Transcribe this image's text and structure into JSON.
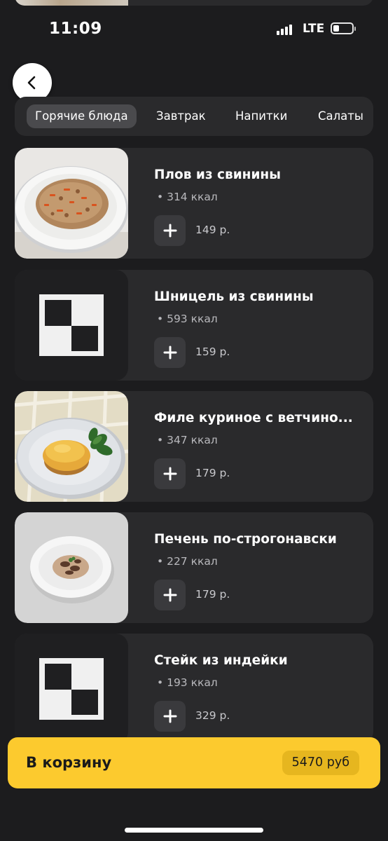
{
  "status_bar": {
    "time": "11:09",
    "network": "LTE",
    "signal_icon": "cellular-signal-icon",
    "battery_icon": "battery-low-icon"
  },
  "nav": {
    "back_icon": "chevron-left-icon"
  },
  "tabs": [
    {
      "label": "Горячие блюда",
      "active": true
    },
    {
      "label": "Завтрак",
      "active": false
    },
    {
      "label": "Напитки",
      "active": false
    },
    {
      "label": "Салаты",
      "active": false
    }
  ],
  "items": [
    {
      "name": "Плов из свинины",
      "kcal": "314 ккал",
      "price": "149 р.",
      "image": "photo-pilaf"
    },
    {
      "name": "Шницель из свинины",
      "kcal": "593 ккал",
      "price": "159 р.",
      "image": "placeholder-image-icon"
    },
    {
      "name": "Филе куриное с ветчино...",
      "kcal": "347 ккал",
      "price": "179 р.",
      "image": "photo-chicken"
    },
    {
      "name": "Печень по-строгонавски",
      "kcal": "227 ккал",
      "price": "179 р.",
      "image": "photo-liver"
    },
    {
      "name": "Стейк из индейки",
      "kcal": "193 ккал",
      "price": "329 р.",
      "image": "placeholder-image-icon"
    }
  ],
  "cart": {
    "label": "В корзину",
    "total": "5470 руб"
  },
  "colors": {
    "background": "#1c1c1e",
    "card": "#2a2a2c",
    "accent": "#fcca2e"
  }
}
